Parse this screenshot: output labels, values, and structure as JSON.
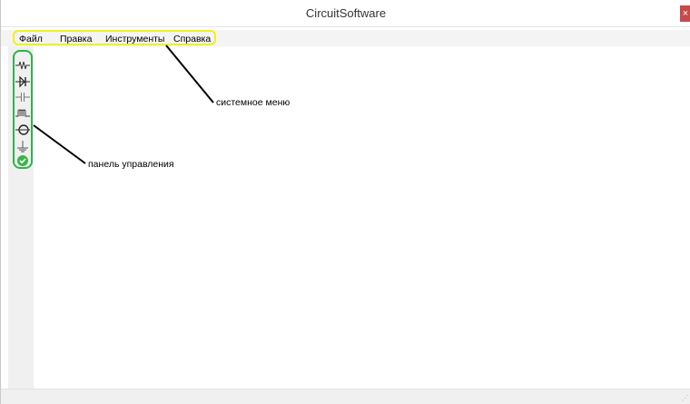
{
  "window": {
    "title": "CircuitSoftware",
    "close_glyph": "×"
  },
  "menu": {
    "items": [
      {
        "label": "Файл"
      },
      {
        "label": "Правка"
      },
      {
        "label": "Инструменты"
      },
      {
        "label": "Справка"
      }
    ]
  },
  "toolbar": {
    "tools": [
      {
        "icon": "resistor-icon"
      },
      {
        "icon": "diode-icon"
      },
      {
        "icon": "capacitor-icon"
      },
      {
        "icon": "inductor-icon"
      },
      {
        "icon": "lamp-icon"
      },
      {
        "icon": "ground-icon"
      },
      {
        "icon": "check-icon"
      }
    ]
  },
  "annotations": {
    "menu_label": "системное меню",
    "panel_label": "панель управления"
  },
  "colors": {
    "menu_highlight": "#f1f11a",
    "panel_highlight": "#2fb34a",
    "close_button": "#c74a4a"
  }
}
